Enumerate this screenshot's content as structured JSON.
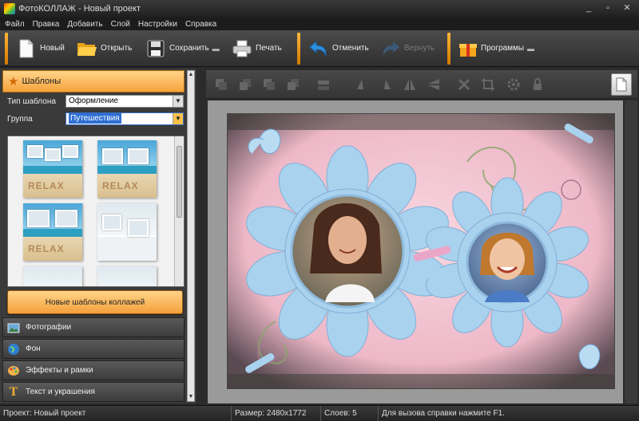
{
  "window": {
    "title": "ФотоКОЛЛАЖ - Новый проект",
    "minimize": "_",
    "maximize": "▫",
    "close": "✕"
  },
  "menu": [
    "Файл",
    "Правка",
    "Добавить",
    "Слой",
    "Настройки",
    "Справка"
  ],
  "toolbar": {
    "new": "Новый",
    "open": "Открыть",
    "save": "Сохранить",
    "print": "Печать",
    "undo": "Отменить",
    "redo": "Вернуть",
    "programs": "Программы"
  },
  "left": {
    "templates_title": "Шаблоны",
    "template_type_label": "Тип шаблона",
    "template_type_value": "Оформление",
    "group_label": "Группа",
    "group_value": "Путешествия",
    "thumb_texts": [
      "RELAX",
      "RELAX",
      "RELAX"
    ],
    "new_templates_button": "Новые шаблоны коллажей",
    "sections": [
      "Фотографии",
      "Фон",
      "Эффекты и рамки",
      "Текст и украшения"
    ]
  },
  "status": {
    "project": "Проект: Новый проект",
    "size": "Размер: 2480x1772",
    "layers": "Слоев: 5",
    "help": "Для вызова справки нажмите F1."
  },
  "colors": {
    "accent": "#f6a23b",
    "panel": "#3a3a3a",
    "flower": "#a9d2ef",
    "background_pink": "#f2c6d4"
  }
}
